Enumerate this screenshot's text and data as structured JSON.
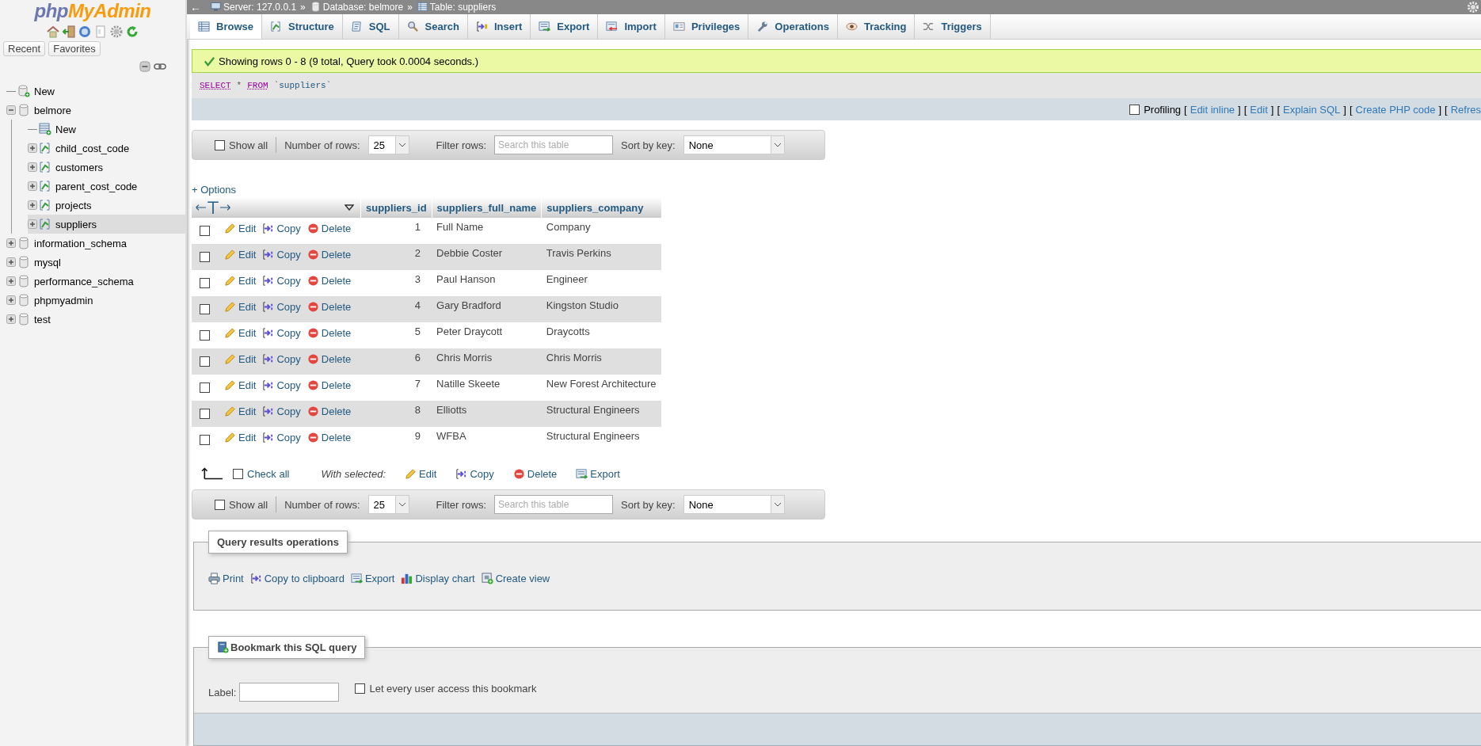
{
  "sidebar": {
    "logo": {
      "php": "php",
      "brand": "MyAdmin"
    },
    "quick_tabs": [
      {
        "label": "Recent"
      },
      {
        "label": "Favorites"
      }
    ],
    "tree": [
      {
        "label": "New",
        "kind": "new-db",
        "selected": false
      },
      {
        "label": "belmore",
        "kind": "db",
        "expanded": true,
        "selected": false,
        "children": [
          {
            "label": "New",
            "kind": "new-table",
            "selected": false
          },
          {
            "label": "child_cost_code",
            "kind": "table",
            "expanded": false,
            "selected": false
          },
          {
            "label": "customers",
            "kind": "table",
            "expanded": false,
            "selected": false
          },
          {
            "label": "parent_cost_code",
            "kind": "table",
            "expanded": false,
            "selected": false
          },
          {
            "label": "projects",
            "kind": "table",
            "expanded": false,
            "selected": false
          },
          {
            "label": "suppliers",
            "kind": "table",
            "expanded": false,
            "selected": true
          }
        ]
      },
      {
        "label": "information_schema",
        "kind": "db",
        "expanded": false,
        "selected": false
      },
      {
        "label": "mysql",
        "kind": "db",
        "expanded": false,
        "selected": false
      },
      {
        "label": "performance_schema",
        "kind": "db",
        "expanded": false,
        "selected": false
      },
      {
        "label": "phpmyadmin",
        "kind": "db",
        "expanded": false,
        "selected": false
      },
      {
        "label": "test",
        "kind": "db",
        "expanded": false,
        "selected": false
      }
    ]
  },
  "breadcrumb": {
    "back": "←",
    "crumbs": [
      {
        "kind": "server",
        "label": "Server: 127.0.0.1",
        "sep": "»"
      },
      {
        "kind": "database",
        "label": "Database: belmore",
        "sep": "»"
      },
      {
        "kind": "table",
        "label": "Table: suppliers"
      }
    ]
  },
  "tabs": [
    {
      "kind": "browse",
      "label": "Browse",
      "selected": true
    },
    {
      "kind": "structure",
      "label": "Structure",
      "selected": false
    },
    {
      "kind": "sql",
      "label": "SQL",
      "selected": false
    },
    {
      "kind": "search",
      "label": "Search",
      "selected": false
    },
    {
      "kind": "insert",
      "label": "Insert",
      "selected": false
    },
    {
      "kind": "export",
      "label": "Export",
      "selected": false
    },
    {
      "kind": "import",
      "label": "Import",
      "selected": false
    },
    {
      "kind": "privileges",
      "label": "Privileges",
      "selected": false
    },
    {
      "kind": "operations",
      "label": "Operations",
      "selected": false
    },
    {
      "kind": "tracking",
      "label": "Tracking",
      "selected": false
    },
    {
      "kind": "triggers",
      "label": "Triggers",
      "selected": false
    }
  ],
  "message": "Showing rows 0 - 8 (9 total, Query took 0.0004 seconds.)",
  "sql": [
    {
      "kind": "keyword",
      "text": "SELECT"
    },
    {
      "kind": "operator",
      "text": "*"
    },
    {
      "kind": "keyword",
      "text": "FROM"
    },
    {
      "kind": "identifier",
      "text": "`suppliers`"
    }
  ],
  "profiling": {
    "label": "Profiling",
    "checked": false,
    "links": [
      {
        "before": "[",
        "label": "Edit inline",
        "after": "]"
      },
      {
        "before": "[",
        "label": "Edit",
        "after": "]"
      },
      {
        "before": "[",
        "label": "Explain SQL",
        "after": "]"
      },
      {
        "before": "[",
        "label": "Create PHP code",
        "after": "]"
      },
      {
        "before": "[",
        "label": "Refres"
      }
    ]
  },
  "nav_bars": [
    {
      "show_all": {
        "label": "Show all",
        "checked": false
      },
      "rows_label": "Number of rows:",
      "rows_value": "25",
      "filter_label": "Filter rows:",
      "filter_placeholder": "Search this table",
      "sort_label": "Sort by key:",
      "sort_value": "None"
    },
    {
      "show_all": {
        "label": "Show all",
        "checked": false
      },
      "rows_label": "Number of rows:",
      "rows_value": "25",
      "filter_label": "Filter rows:",
      "filter_placeholder": "Search this table",
      "sort_label": "Sort by key:",
      "sort_value": "None"
    }
  ],
  "options": "+ Options",
  "table": {
    "columns": [
      "suppliers_id",
      "suppliers_full_name",
      "suppliers_company"
    ],
    "rows": [
      {
        "checked": false,
        "actions": [
          {
            "kind": "edit",
            "label": "Edit"
          },
          {
            "kind": "copy",
            "label": "Copy"
          },
          {
            "kind": "delete",
            "label": "Delete"
          }
        ],
        "cells": [
          "1",
          "Full Name",
          "Company"
        ]
      },
      {
        "checked": false,
        "actions": [
          {
            "kind": "edit",
            "label": "Edit"
          },
          {
            "kind": "copy",
            "label": "Copy"
          },
          {
            "kind": "delete",
            "label": "Delete"
          }
        ],
        "cells": [
          "2",
          "Debbie Coster",
          "Travis Perkins"
        ]
      },
      {
        "checked": false,
        "actions": [
          {
            "kind": "edit",
            "label": "Edit"
          },
          {
            "kind": "copy",
            "label": "Copy"
          },
          {
            "kind": "delete",
            "label": "Delete"
          }
        ],
        "cells": [
          "3",
          "Paul Hanson",
          "Engineer"
        ]
      },
      {
        "checked": false,
        "actions": [
          {
            "kind": "edit",
            "label": "Edit"
          },
          {
            "kind": "copy",
            "label": "Copy"
          },
          {
            "kind": "delete",
            "label": "Delete"
          }
        ],
        "cells": [
          "4",
          "Gary Bradford",
          "Kingston Studio"
        ]
      },
      {
        "checked": false,
        "actions": [
          {
            "kind": "edit",
            "label": "Edit"
          },
          {
            "kind": "copy",
            "label": "Copy"
          },
          {
            "kind": "delete",
            "label": "Delete"
          }
        ],
        "cells": [
          "5",
          "Peter Draycott",
          "Draycotts"
        ]
      },
      {
        "checked": false,
        "actions": [
          {
            "kind": "edit",
            "label": "Edit"
          },
          {
            "kind": "copy",
            "label": "Copy"
          },
          {
            "kind": "delete",
            "label": "Delete"
          }
        ],
        "cells": [
          "6",
          "Chris Morris",
          "Chris Morris"
        ]
      },
      {
        "checked": false,
        "actions": [
          {
            "kind": "edit",
            "label": "Edit"
          },
          {
            "kind": "copy",
            "label": "Copy"
          },
          {
            "kind": "delete",
            "label": "Delete"
          }
        ],
        "cells": [
          "7",
          "Natille Skeete",
          "New Forest Architecture"
        ]
      },
      {
        "checked": false,
        "actions": [
          {
            "kind": "edit",
            "label": "Edit"
          },
          {
            "kind": "copy",
            "label": "Copy"
          },
          {
            "kind": "delete",
            "label": "Delete"
          }
        ],
        "cells": [
          "8",
          "Elliotts",
          "Structural Engineers"
        ]
      },
      {
        "checked": false,
        "actions": [
          {
            "kind": "edit",
            "label": "Edit"
          },
          {
            "kind": "copy",
            "label": "Copy"
          },
          {
            "kind": "delete",
            "label": "Delete"
          }
        ],
        "cells": [
          "9",
          "WFBA",
          "Structural Engineers"
        ]
      }
    ]
  },
  "bulk": {
    "check_all": {
      "label": "Check all",
      "checked": false
    },
    "with_selected": "With selected:",
    "actions": [
      {
        "kind": "edit",
        "label": "Edit"
      },
      {
        "kind": "copy",
        "label": "Copy"
      },
      {
        "kind": "delete",
        "label": "Delete"
      },
      {
        "kind": "export",
        "label": "Export"
      }
    ]
  },
  "query_ops": {
    "legend": "Query results operations",
    "items": [
      {
        "kind": "print",
        "label": "Print"
      },
      {
        "kind": "copy",
        "label": "Copy to clipboard"
      },
      {
        "kind": "export",
        "label": "Export"
      },
      {
        "kind": "chart",
        "label": "Display chart"
      },
      {
        "kind": "create-view",
        "label": "Create view"
      }
    ]
  },
  "bookmark": {
    "legend": "Bookmark this SQL query",
    "label": "Label:",
    "share": {
      "label": "Let every user access this bookmark",
      "checked": false
    }
  }
}
